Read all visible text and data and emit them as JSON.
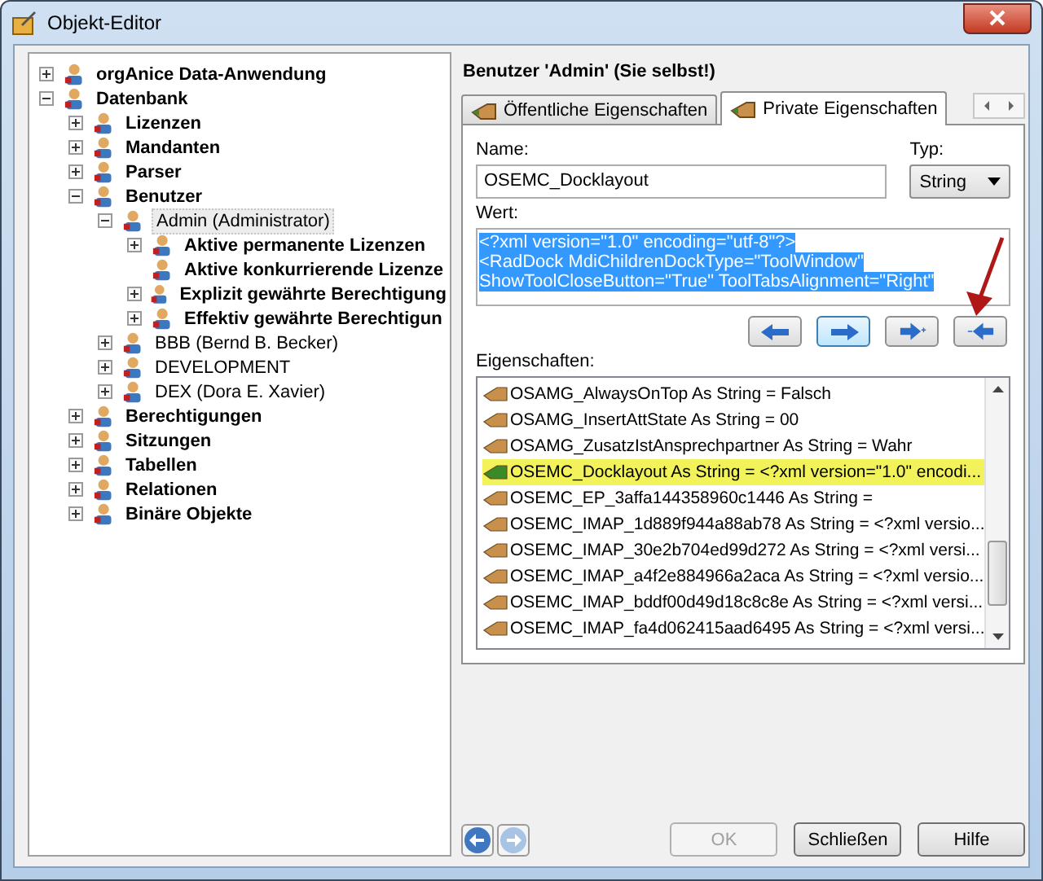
{
  "window": {
    "title": "Objekt-Editor"
  },
  "tree": [
    {
      "label": "orgAnice Data-Anwendung",
      "bold": true,
      "selected": false,
      "expanded": false
    },
    {
      "label": "Datenbank",
      "bold": true,
      "selected": false,
      "expanded": true,
      "children": [
        {
          "label": "Lizenzen",
          "bold": true,
          "selected": false,
          "expanded": false
        },
        {
          "label": "Mandanten",
          "bold": true,
          "selected": false,
          "expanded": false
        },
        {
          "label": "Parser",
          "bold": true,
          "selected": false,
          "expanded": false
        },
        {
          "label": "Benutzer",
          "bold": true,
          "selected": false,
          "expanded": true,
          "children": [
            {
              "label": "Admin (Administrator)",
              "bold": false,
              "selected": true,
              "expanded": true,
              "children": [
                {
                  "label": "Aktive permanente Lizenzen",
                  "bold": true,
                  "selected": false,
                  "expanded": false
                },
                {
                  "label": "Aktive konkurrierende Lizenze",
                  "bold": true,
                  "selected": false
                },
                {
                  "label": "Explizit gewährte Berechtigung",
                  "bold": true,
                  "selected": false,
                  "expanded": false
                },
                {
                  "label": "Effektiv gewährte Berechtigun",
                  "bold": true,
                  "selected": false,
                  "expanded": false
                }
              ]
            },
            {
              "label": "BBB (Bernd B. Becker)",
              "bold": false,
              "selected": false,
              "expanded": false
            },
            {
              "label": "DEVELOPMENT",
              "bold": false,
              "selected": false,
              "expanded": false
            },
            {
              "label": "DEX (Dora E. Xavier)",
              "bold": false,
              "selected": false,
              "expanded": false
            }
          ]
        },
        {
          "label": "Berechtigungen",
          "bold": true,
          "selected": false,
          "expanded": false
        },
        {
          "label": "Sitzungen",
          "bold": true,
          "selected": false,
          "expanded": false
        },
        {
          "label": "Tabellen",
          "bold": true,
          "selected": false,
          "expanded": false
        },
        {
          "label": "Relationen",
          "bold": true,
          "selected": false,
          "expanded": false
        },
        {
          "label": "Binäre Objekte",
          "bold": true,
          "selected": false,
          "expanded": false
        }
      ]
    }
  ],
  "header": "Benutzer 'Admin' (Sie selbst!)",
  "tabs": [
    {
      "label": "Öffentliche Eigenschaften",
      "selected": false
    },
    {
      "label": "Private Eigenschaften",
      "selected": true
    }
  ],
  "name": {
    "label": "Name:",
    "value": "OSEMC_Docklayout"
  },
  "type": {
    "label": "Typ:",
    "value": "String"
  },
  "value": {
    "label": "Wert:",
    "lines": [
      "<?xml version=\"1.0\" encoding=\"utf-8\"?>",
      "<RadDock MdiChildrenDockType=\"ToolWindow\"",
      "ShowToolCloseButton=\"True\" ToolTabsAlignment=\"Right\""
    ]
  },
  "properties": {
    "label": "Eigenschaften:",
    "items": [
      {
        "text": "OSAMG_AlwaysOnTop As String = Falsch",
        "selected": false
      },
      {
        "text": "OSAMG_InsertAttState As String = 00",
        "selected": false
      },
      {
        "text": "OSAMG_ZusatzIstAnsprechpartner As String = Wahr",
        "selected": false
      },
      {
        "text": "OSEMC_Docklayout As String = <?xml version=\"1.0\" encodi...",
        "selected": true
      },
      {
        "text": "OSEMC_EP_3affa144358960c1446 As String =",
        "selected": false
      },
      {
        "text": "OSEMC_IMAP_1d889f944a88ab78 As String = <?xml versio...",
        "selected": false
      },
      {
        "text": "OSEMC_IMAP_30e2b704ed99d272 As String = <?xml versi...",
        "selected": false
      },
      {
        "text": "OSEMC_IMAP_a4f2e884966a2aca As String = <?xml versio...",
        "selected": false
      },
      {
        "text": "OSEMC_IMAP_bddf00d49d18c8c8e As String = <?xml versi...",
        "selected": false
      },
      {
        "text": "OSEMC_IMAP_fa4d062415aad6495 As String = <?xml versi...",
        "selected": false
      }
    ]
  },
  "buttons": [
    {
      "label": "OK",
      "disabled": true
    },
    {
      "label": "Schließen",
      "disabled": false
    },
    {
      "label": "Hilfe",
      "disabled": false
    }
  ]
}
